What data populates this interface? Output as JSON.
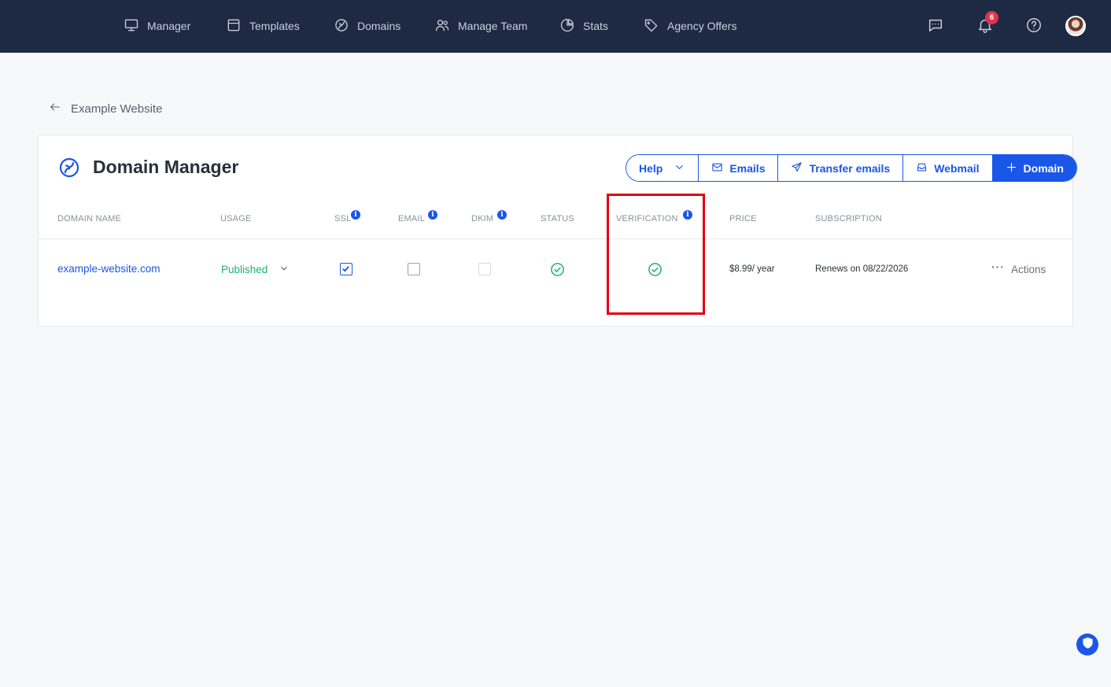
{
  "nav": {
    "items": [
      {
        "label": "Manager",
        "icon": "monitor-icon"
      },
      {
        "label": "Templates",
        "icon": "template-icon"
      },
      {
        "label": "Domains",
        "icon": "domains-icon"
      },
      {
        "label": "Manage Team",
        "icon": "team-icon"
      },
      {
        "label": "Stats",
        "icon": "pie-chart-icon"
      },
      {
        "label": "Agency Offers",
        "icon": "tag-icon"
      }
    ],
    "notification_count": "6"
  },
  "breadcrumb": {
    "back_label": "Example Website"
  },
  "page": {
    "title": "Domain Manager"
  },
  "toolbar": {
    "help_label": "Help",
    "emails_label": "Emails",
    "transfer_label": "Transfer emails",
    "webmail_label": "Webmail",
    "add_domain_label": "Domain"
  },
  "table": {
    "headers": [
      "DOMAIN NAME",
      "USAGE",
      "SSL",
      "EMAIL",
      "DKIM",
      "STATUS",
      "VERIFICATION",
      "PRICE",
      "SUBSCRIPTION"
    ],
    "row": {
      "domain": "example-website.com",
      "usage": "Published",
      "ssl": true,
      "email": false,
      "dkim": false,
      "status": "ok",
      "verification": "ok",
      "price": "$8.99/ year",
      "subscription": "Renews on 08/22/2026",
      "actions_label": "Actions"
    }
  },
  "colors": {
    "nav_bg": "#1e2a44",
    "accent": "#1a56e8",
    "success": "#20b26b",
    "highlight": "#e3000f",
    "badge": "#e0344b"
  }
}
